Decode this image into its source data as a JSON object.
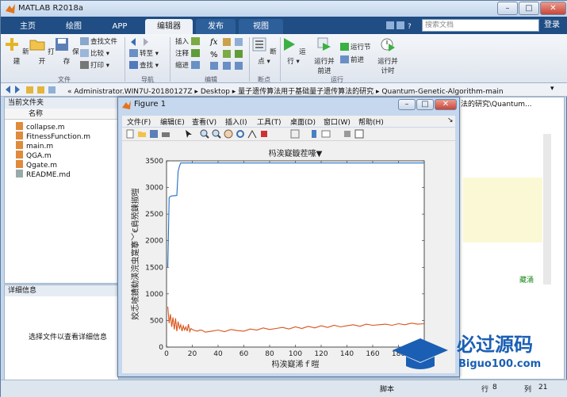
{
  "window": {
    "title": "MATLAB R2018a"
  },
  "tabs": [
    {
      "label": "主页",
      "active": false
    },
    {
      "label": "绘图",
      "active": false
    },
    {
      "label": "APP",
      "active": false
    },
    {
      "label": "编辑器",
      "active": true
    },
    {
      "label": "发布",
      "active": false
    },
    {
      "label": "视图",
      "active": false
    }
  ],
  "search": {
    "placeholder": "搜索文档"
  },
  "login_label": "登录",
  "ribbon": {
    "new": "新建",
    "open": "打开",
    "save": "保存",
    "find_files": "查找文件",
    "compare": "比较",
    "print": "打印",
    "goto": "转至",
    "find": "查找",
    "insert": "插入",
    "comment": "注释",
    "indent": "缩进",
    "breakpoints": "断点",
    "run": "运行",
    "run_advance": [
      "运行并",
      "前进"
    ],
    "run_section": "运行节",
    "advance": "前进",
    "run_time": [
      "运行并",
      "计时"
    ],
    "groups": {
      "file": "文件",
      "navigate": "导航",
      "edit": "编辑",
      "breakpoints": "断点",
      "run": "运行"
    }
  },
  "address": {
    "path": "« Administrator.WIN7U-20180127Z  ▸  Desktop  ▸  量子遗传算法用于基础量子遗传算法的研究  ▸  Quantum-Genetic-Algorithm-main"
  },
  "current_folder": {
    "title": "当前文件夹",
    "column": "名称",
    "files": [
      "collapse.m",
      "FitnessFunction.m",
      "main.m",
      "QGA.m",
      "Qgate.m",
      "README.md"
    ]
  },
  "details": {
    "title": "详细信息",
    "message": "选择文件以查看详细信息"
  },
  "right_panel": {
    "path_fragment": "法的研究\\Quantum...",
    "green_text": "藏涌"
  },
  "status_bar": {
    "mode": "脚本",
    "line_label": "行",
    "line": "8",
    "col_label": "列",
    "col": "21"
  },
  "figure": {
    "title": "Figure 1",
    "menus": [
      "文件(F)",
      "编辑(E)",
      "查看(V)",
      "插入(I)",
      "工具(T)",
      "桌面(D)",
      "窗口(W)",
      "帮助(H)"
    ]
  },
  "chart_data": {
    "type": "line",
    "title": "杩涘寲鏇茬嚎▼",
    "xlabel": "杩涘寲浠ｆ暟",
    "ylabel": "姣忎唬鐨勬渶浣虫寔搴﹀€肩殑鍊掓暟",
    "xlim": [
      0,
      200
    ],
    "ylim": [
      0,
      3500
    ],
    "xticks": [
      0,
      20,
      40,
      60,
      80,
      100,
      120,
      140,
      160,
      180
    ],
    "yticks": [
      0,
      500,
      1000,
      1500,
      2000,
      2500,
      3000,
      3500
    ],
    "series": [
      {
        "color": "#1f6fc2",
        "x": [
          1,
          2,
          3,
          4,
          8,
          9,
          10,
          11,
          12,
          200
        ],
        "y": [
          1500,
          2810,
          2830,
          2840,
          2850,
          3300,
          3400,
          3460,
          3460,
          3460
        ]
      },
      {
        "color": "#d9541a",
        "x": [
          1,
          2,
          3,
          4,
          5,
          6,
          7,
          8,
          9,
          10,
          11,
          12,
          13,
          14,
          15,
          16,
          17,
          18,
          19,
          20,
          22,
          24,
          26,
          28,
          30,
          35,
          40,
          45,
          50,
          55,
          60,
          65,
          70,
          75,
          80,
          85,
          90,
          95,
          100,
          105,
          110,
          115,
          120,
          125,
          130,
          135,
          140,
          145,
          150,
          155,
          160,
          165,
          170,
          175,
          180,
          185,
          190,
          195,
          200
        ],
        "y": [
          760,
          450,
          620,
          380,
          560,
          330,
          540,
          300,
          480,
          350,
          420,
          300,
          400,
          320,
          380,
          300,
          430,
          290,
          350,
          330,
          310,
          300,
          320,
          310,
          280,
          300,
          320,
          290,
          330,
          310,
          300,
          340,
          320,
          360,
          330,
          350,
          370,
          340,
          380,
          350,
          390,
          360,
          400,
          370,
          410,
          380,
          400,
          420,
          390,
          430,
          410,
          420,
          430,
          410,
          440,
          420,
          450,
          430,
          440
        ]
      }
    ]
  }
}
